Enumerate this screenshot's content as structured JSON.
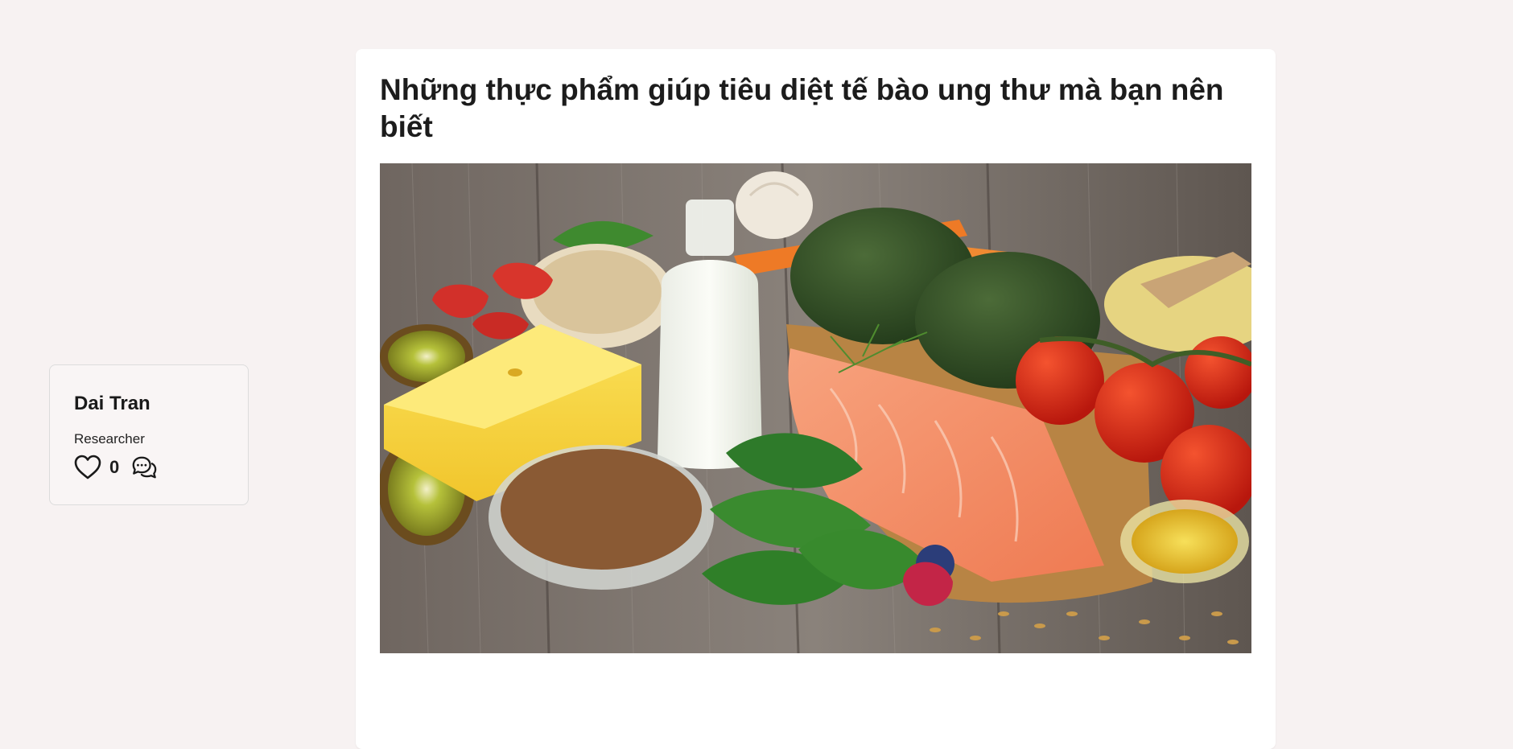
{
  "author": {
    "name": "Dai Tran",
    "role": "Researcher",
    "like_count": "0",
    "icons": {
      "like": "heart-outline-icon",
      "comment": "chat-bubbles-icon"
    }
  },
  "article": {
    "title": "Những thực phẩm giúp tiêu diệt tế bào ung thư mà bạn nên biết",
    "cover_image": "photo of healthy foods on a wooden table"
  },
  "colors": {
    "page_background": "#f7f2f2",
    "card_background": "#ffffff",
    "text": "#1c1c1c"
  }
}
